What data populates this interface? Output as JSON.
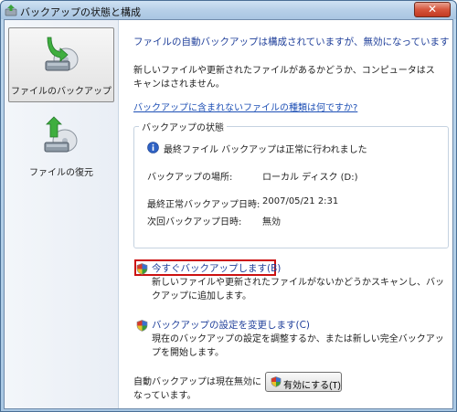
{
  "window": {
    "title": "バックアップの状態と構成",
    "close_glyph": "✕"
  },
  "nav": {
    "items": [
      {
        "label": "ファイルのバックアップ",
        "icon": "backup-disk-icon",
        "selected": true
      },
      {
        "label": "ファイルの復元",
        "icon": "restore-disk-icon",
        "selected": false
      }
    ]
  },
  "main": {
    "heading": "ファイルの自動バックアップは構成されていますが、無効になっています",
    "description": "新しいファイルや更新されたファイルがあるかどうか、コンピュータはスキャンはされません。",
    "link": "バックアップに含まれないファイルの種類は何ですか?",
    "status_group": {
      "title": "バックアップの状態",
      "info": "最終ファイル バックアップは正常に行われました",
      "rows": [
        {
          "label": "バックアップの場所:",
          "value": "ローカル ディスク (D:)"
        },
        {
          "label": "最終正常バックアップ日時:",
          "value": "2007/05/21 2:31"
        },
        {
          "label": "次回バックアップ日時:",
          "value": "無効"
        }
      ]
    },
    "tasks": [
      {
        "title": "今すぐバックアップします(B)",
        "description": "新しいファイルや更新されたファイルがないかどうかスキャンし、バックアップに追加します。"
      },
      {
        "title": "バックアップの設定を変更します(C)",
        "description": "現在のバックアップの設定を調整するか、または新しい完全バックアップを開始します。"
      }
    ],
    "footer": {
      "status": "自動バックアップは現在無効になっています。",
      "enable_button": "有効にする(T)"
    }
  },
  "colors": {
    "link": "#1d4fb5",
    "heading": "#1f3f9a",
    "highlight": "#cc1111",
    "shield_green": "#3a9a3a",
    "shield_red": "#d63a2a"
  }
}
